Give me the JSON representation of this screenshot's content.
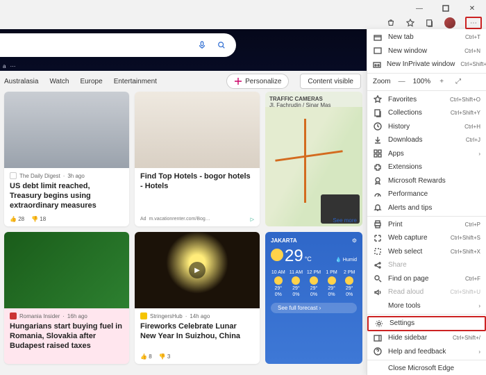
{
  "window": {
    "minimize": "—",
    "maximize": "▢",
    "close": "✕"
  },
  "toolbar": {
    "more": "⋯"
  },
  "nav": {
    "items": [
      "Australasia",
      "Watch",
      "Europe",
      "Entertainment"
    ],
    "personalize": "Personalize",
    "content_visible": "Content visible"
  },
  "cards": {
    "a": {
      "source": "The Daily Digest",
      "age": "3h ago",
      "title": "US debt limit reached, Treasury begins using extraordinary measures",
      "likes": "28",
      "dislikes": "18"
    },
    "b": {
      "title": "Find Top Hotels - bogor hotels - Hotels",
      "ad_label": "Ad",
      "ad_url": "m.vacationrenter.com/Bog…"
    },
    "c": {
      "header": "TRAFFIC CAMERAS",
      "sub": "Jl. Fachrudin / Sinar Mas",
      "more": "See more"
    },
    "d": {
      "source": "Romania Insider",
      "age": "16h ago",
      "title": "Hungarians start buying fuel in Romania, Slovakia after Budapest raised taxes"
    },
    "e": {
      "source": "StringersHub",
      "age": "14h ago",
      "title": "Fireworks Celebrate Lunar New Year In Suizhou, China",
      "likes": "8",
      "dislikes": "3"
    },
    "w": {
      "city": "JAKARTA",
      "temp": "29",
      "unit": "°C",
      "hum": "Humid",
      "hours": [
        "10 AM",
        "11 AM",
        "12 PM",
        "1 PM",
        "2 PM"
      ],
      "temps": [
        "29°",
        "29°",
        "29°",
        "29°",
        "29°"
      ],
      "precip": [
        "0%",
        "0%",
        "0%",
        "0%",
        "0%"
      ],
      "button": "See full forecast"
    }
  },
  "menu": {
    "new_tab": {
      "l": "New tab",
      "s": "Ctrl+T"
    },
    "new_window": {
      "l": "New window",
      "s": "Ctrl+N"
    },
    "inprivate": {
      "l": "New InPrivate window",
      "s": "Ctrl+Shift+N"
    },
    "zoom": {
      "l": "Zoom",
      "v": "100%"
    },
    "favorites": {
      "l": "Favorites",
      "s": "Ctrl+Shift+O"
    },
    "collections": {
      "l": "Collections",
      "s": "Ctrl+Shift+Y"
    },
    "history": {
      "l": "History",
      "s": "Ctrl+H"
    },
    "downloads": {
      "l": "Downloads",
      "s": "Ctrl+J"
    },
    "apps": {
      "l": "Apps"
    },
    "extensions": {
      "l": "Extensions"
    },
    "rewards": {
      "l": "Microsoft Rewards"
    },
    "performance": {
      "l": "Performance"
    },
    "alerts": {
      "l": "Alerts and tips"
    },
    "print": {
      "l": "Print",
      "s": "Ctrl+P"
    },
    "capture": {
      "l": "Web capture",
      "s": "Ctrl+Shift+S"
    },
    "select": {
      "l": "Web select",
      "s": "Ctrl+Shift+X"
    },
    "share": {
      "l": "Share"
    },
    "find": {
      "l": "Find on page",
      "s": "Ctrl+F"
    },
    "read": {
      "l": "Read aloud",
      "s": "Ctrl+Shift+U"
    },
    "tools": {
      "l": "More tools"
    },
    "settings": {
      "l": "Settings"
    },
    "sidebar": {
      "l": "Hide sidebar",
      "s": "Ctrl+Shift+/"
    },
    "help": {
      "l": "Help and feedback"
    },
    "close": {
      "l": "Close Microsoft Edge"
    }
  }
}
